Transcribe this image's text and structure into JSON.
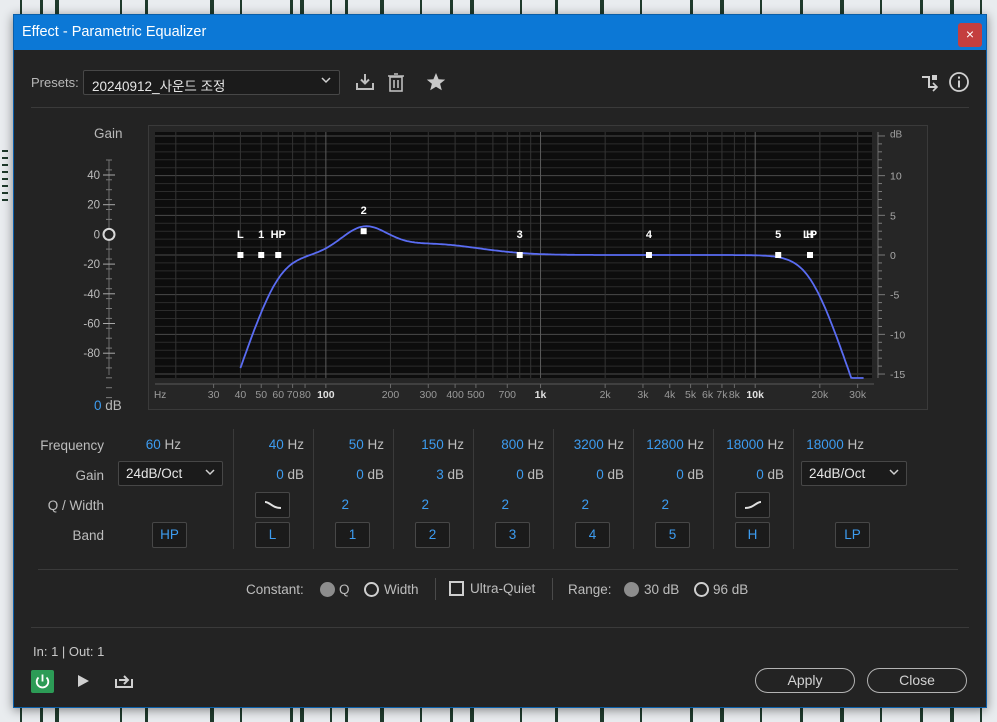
{
  "window": {
    "title": "Effect - Parametric Equalizer",
    "close_glyph": "×"
  },
  "presets": {
    "label": "Presets:",
    "value": "20240912_사운드 조정",
    "icons": [
      "download-icon",
      "trash-icon",
      "star-icon",
      "routing-icon",
      "info-icon"
    ]
  },
  "graph": {
    "gain_label": "Gain",
    "gain_value": "0",
    "gain_unit": "dB",
    "left_scale": [
      "40",
      "20",
      "0",
      "-20",
      "-40",
      "-60",
      "-80"
    ],
    "right_unit": "dB",
    "right_scale": [
      "10",
      "5",
      "0",
      "-5",
      "-10",
      "-15"
    ],
    "freq_unit": "Hz",
    "freq_ticks": [
      "30",
      "40",
      "50",
      "60",
      "70",
      "80",
      "100",
      "200",
      "300",
      "400",
      "500",
      "700",
      "1k",
      "2k",
      "3k",
      "4k",
      "5k",
      "6k",
      "7k",
      "8k",
      "10k",
      "20k",
      "30k"
    ],
    "node_labels": [
      "L",
      "1",
      "HP",
      "2",
      "3",
      "4",
      "5",
      "H",
      "LP"
    ],
    "curve_color": "#5a6cf2"
  },
  "rows": {
    "frequency": "Frequency",
    "gain": "Gain",
    "q_width": "Q / Width",
    "band": "Band"
  },
  "bands": {
    "hp": {
      "freq": "60",
      "freq_unit": "Hz",
      "slope": "24dB/Oct",
      "label": "HP"
    },
    "l": {
      "freq": "40",
      "freq_unit": "Hz",
      "gain": "0",
      "gain_unit": "dB",
      "label": "L",
      "shape_icon": "low-shelf-icon"
    },
    "b1": {
      "freq": "50",
      "freq_unit": "Hz",
      "gain": "0",
      "gain_unit": "dB",
      "q": "2",
      "label": "1"
    },
    "b2": {
      "freq": "150",
      "freq_unit": "Hz",
      "gain": "3",
      "gain_unit": "dB",
      "q": "2",
      "label": "2"
    },
    "b3": {
      "freq": "800",
      "freq_unit": "Hz",
      "gain": "0",
      "gain_unit": "dB",
      "q": "2",
      "label": "3"
    },
    "b4": {
      "freq": "3200",
      "freq_unit": "Hz",
      "gain": "0",
      "gain_unit": "dB",
      "q": "2",
      "label": "4"
    },
    "b5": {
      "freq": "12800",
      "freq_unit": "Hz",
      "gain": "0",
      "gain_unit": "dB",
      "q": "2",
      "label": "5"
    },
    "h": {
      "freq": "18000",
      "freq_unit": "Hz",
      "gain": "0",
      "gain_unit": "dB",
      "label": "H",
      "shape_icon": "high-shelf-icon"
    },
    "lp": {
      "freq": "18000",
      "freq_unit": "Hz",
      "slope": "24dB/Oct",
      "label": "LP"
    }
  },
  "constant": {
    "label": "Constant:",
    "q": "Q",
    "width": "Width",
    "selected": "Q",
    "ultra_quiet": "Ultra-Quiet",
    "ultra_quiet_checked": false,
    "range_label": "Range:",
    "range_30": "30 dB",
    "range_96": "96 dB",
    "range_selected": "30 dB"
  },
  "io": {
    "text": "In: 1 | Out: 1"
  },
  "buttons": {
    "apply": "Apply",
    "close": "Close"
  },
  "colors": {
    "accent": "#0c78d6",
    "value_blue": "#3d9cf0",
    "power_on": "#2c9b56",
    "close_red": "#c43f3f"
  }
}
